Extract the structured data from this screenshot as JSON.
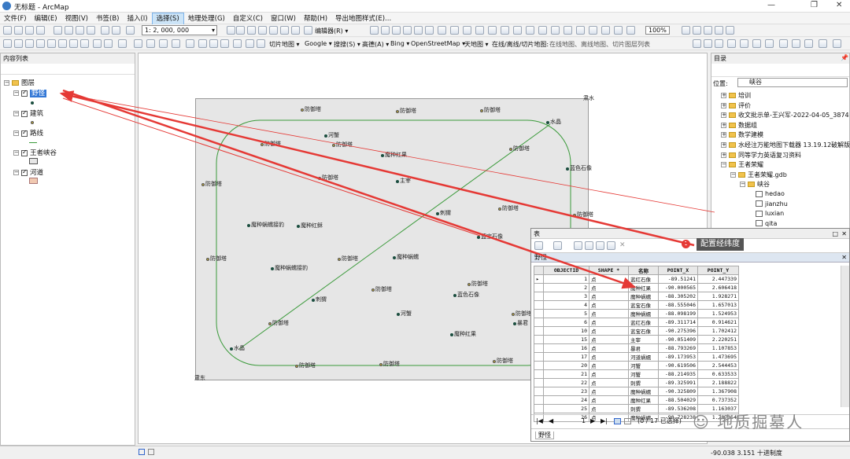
{
  "window": {
    "title": "无标题 - ArcMap"
  },
  "menus": [
    "文件(F)",
    "编辑(E)",
    "视图(V)",
    "书签(B)",
    "插入(I)",
    "选择(S)",
    "地理处理(G)",
    "自定义(C)",
    "窗口(W)",
    "帮助(H)",
    "导出地图样式(E)..."
  ],
  "toolbar": {
    "scale": "1: 2, 000, 000",
    "editor": "编辑器(R) ▾",
    "zoom": "100%",
    "row3": [
      "切片地图 ▾",
      "Google ▾",
      "搜搜(S) ▾",
      "高德(A) ▾",
      "Bing ▾",
      "OpenStreetMap ▾",
      "天地图 ▾",
      "在线/离线/切片地图:",
      "在线地图、离线地图、切片图层列表"
    ]
  },
  "toc": {
    "title": "内容列表",
    "root": "图层",
    "layers": [
      {
        "name": "野怪",
        "selected": true
      },
      {
        "name": "建筑"
      },
      {
        "name": "路线"
      },
      {
        "name": "王者峡谷"
      },
      {
        "name": "河道"
      }
    ]
  },
  "map": {
    "corner_ne": "肃水",
    "corner_sw": "肃东",
    "labels": [
      "防御塔",
      "防御塔",
      "防御塔",
      "水晶",
      "防御塔",
      "防御塔",
      "防御塔",
      "河蟹",
      "魔种红果",
      "蓝色石像",
      "防御塔",
      "防御塔",
      "主宰",
      "刺猬",
      "防御塔",
      "魔种红稣",
      "蓝宝石像",
      "防御塔",
      "魔种蜗蠕接豹",
      "防御塔",
      "魔种蜗蠕接豹",
      "魔种蜗蠕",
      "防御塔",
      "防御塔",
      "刺猬",
      "防御塔",
      "蓝色石像",
      "暴君",
      "防御塔",
      "河蟹",
      "防御塔",
      "魔种红果",
      "水晶",
      "防御塔",
      "防御塔",
      "防御塔"
    ]
  },
  "catalog": {
    "title": "目录",
    "location_label": "位置:",
    "location_value": "峡谷",
    "items": [
      "培训",
      "评价",
      "收文批示单-王兴军-2022-04-05_3874",
      "数据组",
      "数学建模",
      "水经注万能地图下载器 13.19.12破解版",
      "同等学力英语复习资料",
      "王者荣耀",
      "王者荣耀.gdb",
      "峡谷",
      "hedao",
      "jianzhu",
      "luxian",
      "qita",
      "xiagu",
      "yeguai"
    ]
  },
  "table": {
    "title": "表",
    "layer_tab": "野怪",
    "tooltip": "配置经纬度",
    "tooltip_badge": "1",
    "columns": [
      "OBJECTID",
      "SHAPE *",
      "名称",
      "POINT_X",
      "POINT_Y"
    ],
    "rows": [
      [
        "1",
        "点",
        "蓝红石像",
        "-89.51241",
        "2.447339"
      ],
      [
        "2",
        "点",
        "魔种红果",
        "-90.000565",
        "2.606418"
      ],
      [
        "3",
        "点",
        "魔种蜗蠕",
        "-88.305202",
        "1.928271"
      ],
      [
        "4",
        "点",
        "蓝宝石像",
        "-88.555046",
        "1.657013"
      ],
      [
        "5",
        "点",
        "魔种蜗蠕",
        "-88.098199",
        "1.524953"
      ],
      [
        "6",
        "点",
        "蓝红石像",
        "-89.311714",
        "0.914621"
      ],
      [
        "10",
        "点",
        "蓝宝石像",
        "-90.275396",
        "1.702412"
      ],
      [
        "15",
        "点",
        "主宰",
        "-90.051409",
        "2.220251"
      ],
      [
        "16",
        "点",
        "暴君",
        "-88.793269",
        "1.107853"
      ],
      [
        "17",
        "点",
        "河道蜗蠕",
        "-89.173953",
        "1.473695"
      ],
      [
        "20",
        "点",
        "河蟹",
        "-90.619506",
        "2.544453"
      ],
      [
        "21",
        "点",
        "河蟹",
        "-88.214935",
        "0.633533"
      ],
      [
        "22",
        "点",
        "刺猬",
        "-89.325991",
        "2.188822"
      ],
      [
        "23",
        "点",
        "魔种蜗蠕",
        "-90.325809",
        "1.367908"
      ],
      [
        "24",
        "点",
        "魔种红果",
        "-88.504029",
        "0.737352"
      ],
      [
        "25",
        "点",
        "刺猬",
        "-89.536208",
        "1.163037"
      ],
      [
        "26",
        "点",
        "魔种蜗蠕",
        "-90.728238",
        "1.787054"
      ]
    ],
    "nav_page": "1",
    "selection_status": "(0 / 17 已选择)"
  },
  "status": {
    "coords": "-90.038  3.151 十进制度"
  },
  "watermark": "地质掘墓人"
}
